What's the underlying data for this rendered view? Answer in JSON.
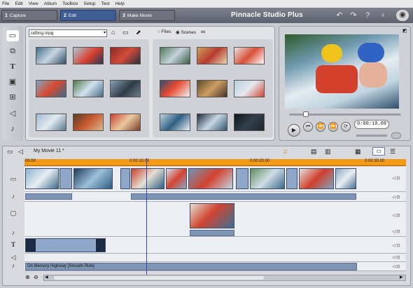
{
  "menu": [
    "File",
    "Edit",
    "View",
    "Album",
    "Toolbox",
    "Setup",
    "Test",
    "Help"
  ],
  "tabs": [
    {
      "num": "1",
      "label": "Capture"
    },
    {
      "num": "2",
      "label": "Edit"
    },
    {
      "num": "3",
      "label": "Make Movie"
    }
  ],
  "app_title": "Pinnacle Studio Plus",
  "album": {
    "file": "rafting.mpg",
    "view_files": "Files",
    "view_scenes": "Scenes"
  },
  "preview": {
    "timecode": "0:00:10.09"
  },
  "timeline": {
    "movie_title": "My Movie 11 *",
    "ruler": [
      "00.00",
      "0:00:10.00",
      "0:00:20.00",
      "0:00:30.00"
    ],
    "audio_clip": "On Memory Highway [Smooth Ride]"
  },
  "colors": {
    "ruler": "#f49a16",
    "clip_border": "#3d4a6a",
    "playhead": "#3a44b0"
  }
}
